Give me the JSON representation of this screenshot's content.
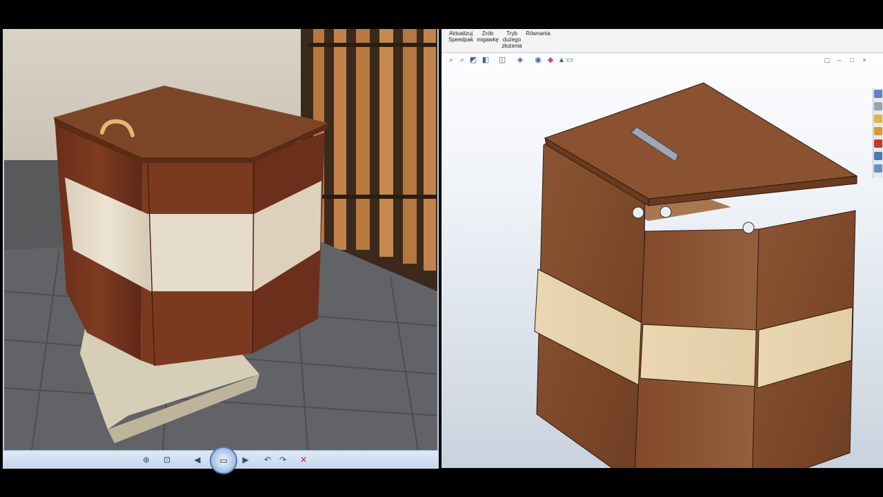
{
  "cad": {
    "ribbon": [
      {
        "id": "update",
        "line1": "Aktualizuj",
        "line2": "Speedpak",
        "line3": ""
      },
      {
        "id": "snapshot",
        "line1": "Zrób",
        "line2": "migawkę",
        "line3": ""
      },
      {
        "id": "large-assembly",
        "line1": "Tryb",
        "line2": "dużego",
        "line3": "złożenia"
      },
      {
        "id": "equations",
        "line1": "Równania",
        "line2": "",
        "line3": ""
      }
    ],
    "hud_icons": [
      "zoom-fit-icon",
      "zoom-area-icon",
      "previous-view-icon",
      "section-view-icon",
      "view-orientation-icon",
      "display-style-icon",
      "hide-show-icon",
      "edit-appearance-icon",
      "apply-scene-icon",
      "view-settings-icon"
    ],
    "taskpane_icons": [
      "home-icon",
      "resources-icon",
      "design-library-icon",
      "file-explorer-icon",
      "view-palette-icon",
      "appearances-icon",
      "custom-properties-icon"
    ]
  },
  "viewer": {
    "buttons": [
      "zoom-icon",
      "fit-icon",
      "previous-icon",
      "slideshow-icon",
      "next-icon",
      "rotate-ccw-icon",
      "rotate-cw-icon",
      "delete-icon"
    ]
  },
  "colors": {
    "walnut": "#7a3f24",
    "light_wood": "#e4d7c3",
    "cad_wood": "#8a5636",
    "cad_light": "#e6d3ae",
    "ui_blue": "#bcd3ea"
  }
}
